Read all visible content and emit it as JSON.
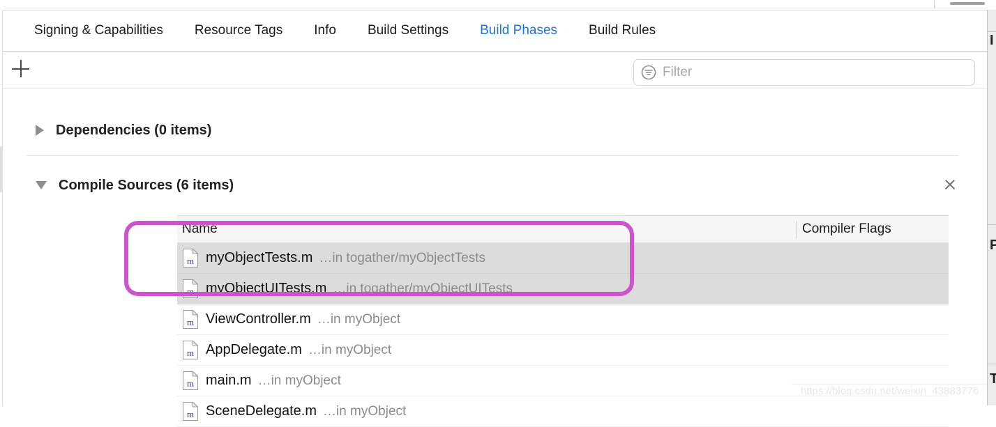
{
  "window": {
    "tab_bar": {
      "tabs": [
        {
          "label": "Signing & Capabilities",
          "active": false
        },
        {
          "label": "Resource Tags",
          "active": false
        },
        {
          "label": "Info",
          "active": false
        },
        {
          "label": "Build Settings",
          "active": false
        },
        {
          "label": "Build Phases",
          "active": true
        },
        {
          "label": "Build Rules",
          "active": false
        }
      ]
    }
  },
  "toolbar": {
    "add_button_label": "+",
    "filter": {
      "placeholder": "Filter",
      "value": "",
      "icon": "filter-icon"
    }
  },
  "phases": [
    {
      "title": "Dependencies (0 items)",
      "expanded": false,
      "disclosure_icon": "triangle-right-icon"
    },
    {
      "title": "Compile Sources (6 items)",
      "expanded": true,
      "disclosure_icon": "triangle-down-icon",
      "close_icon": "close-icon"
    }
  ],
  "file_table": {
    "columns": [
      "Name",
      "Compiler Flags"
    ],
    "rows": [
      {
        "icon": "objc-m-file-icon",
        "name": "myObjectTests.m",
        "location": "…in togather/myObjectTests",
        "compiler_flags": "",
        "selected": true
      },
      {
        "icon": "objc-m-file-icon",
        "name": "myObjectUITests.m",
        "location": "…in togather/myObjectUITests",
        "compiler_flags": "",
        "selected": true
      },
      {
        "icon": "objc-m-file-icon",
        "name": "ViewController.m",
        "location": "…in myObject",
        "compiler_flags": "",
        "selected": false
      },
      {
        "icon": "objc-m-file-icon",
        "name": "AppDelegate.m",
        "location": "…in myObject",
        "compiler_flags": "",
        "selected": false
      },
      {
        "icon": "objc-m-file-icon",
        "name": "main.m",
        "location": "…in myObject",
        "compiler_flags": "",
        "selected": false
      },
      {
        "icon": "objc-m-file-icon",
        "name": "SceneDelegate.m",
        "location": "…in myObject",
        "compiler_flags": "",
        "selected": false
      }
    ]
  },
  "annotation": {
    "shape": "rounded-rectangle",
    "color": "#cc55cc",
    "covers_rows": [
      "myObjectTests.m",
      "myObjectUITests.m"
    ]
  },
  "right_panel": {
    "fragments": [
      "I",
      "P",
      "T"
    ]
  },
  "watermark": {
    "text": "https://blog.csdn.net/weixin_43883776"
  },
  "colors": {
    "accent_blue": "#1b75e2",
    "annotation_magenta": "#cc55cc",
    "selected_row": "#dcdcdc",
    "table_header": "#f6f6f6"
  }
}
